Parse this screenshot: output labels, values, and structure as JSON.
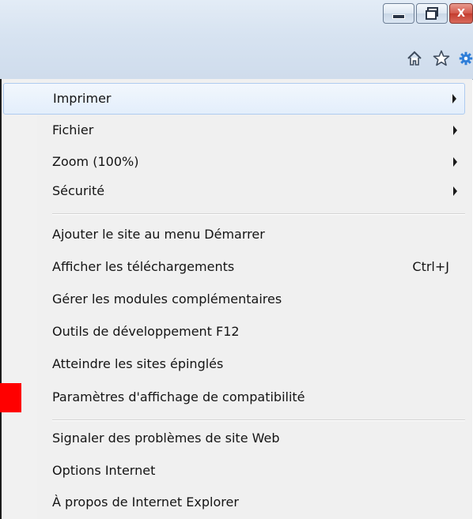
{
  "window": {
    "caption_buttons": [
      {
        "name": "minimize",
        "icon": "minimize-icon"
      },
      {
        "name": "restore",
        "icon": "restore-icon"
      },
      {
        "name": "close",
        "icon": "close-icon",
        "glyph": "X"
      }
    ],
    "toolbar_icons": [
      "home-icon",
      "favorites-star-icon",
      "tools-gear-icon"
    ],
    "colors": {
      "gear": "#2f7ed8",
      "close": "#c43c2e",
      "highlight_border": "#aecbf0"
    }
  },
  "menu": {
    "items": [
      {
        "label": "Imprimer",
        "submenu": true
      },
      {
        "label": "Fichier",
        "submenu": true
      },
      {
        "label": "Zoom (100%)",
        "submenu": true
      },
      {
        "label": "Sécurité",
        "submenu": true
      },
      {
        "label": "Ajouter le site au menu Démarrer"
      },
      {
        "label": "Afficher les téléchargements",
        "shortcut": "Ctrl+J"
      },
      {
        "label": "Gérer les modules complémentaires"
      },
      {
        "label": "Outils de développement F12"
      },
      {
        "label": "Atteindre les sites épinglés"
      },
      {
        "label": "Paramètres d'affichage de compatibilité"
      },
      {
        "label": "Signaler des problèmes de site Web"
      },
      {
        "label": "Options Internet"
      },
      {
        "label": "À propos de Internet Explorer"
      }
    ]
  }
}
